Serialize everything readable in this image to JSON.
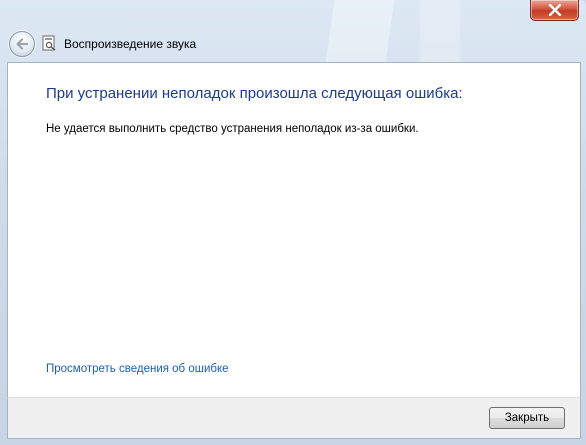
{
  "window": {
    "title": "Воспроизведение звука",
    "title_icon": "troubleshooter-icon",
    "close_icon": "close-icon",
    "back_icon": "back-arrow-icon"
  },
  "content": {
    "heading": "При устранении неполадок произошла следующая ошибка:",
    "message": "Не удается выполнить средство устранения неполадок из-за ошибки.",
    "details_link": "Просмотреть сведения об ошибке"
  },
  "footer": {
    "close_button": "Закрыть"
  },
  "colors": {
    "heading": "#1e3b8a",
    "link": "#1a5fb4",
    "close_button_red": "#c23b22"
  }
}
